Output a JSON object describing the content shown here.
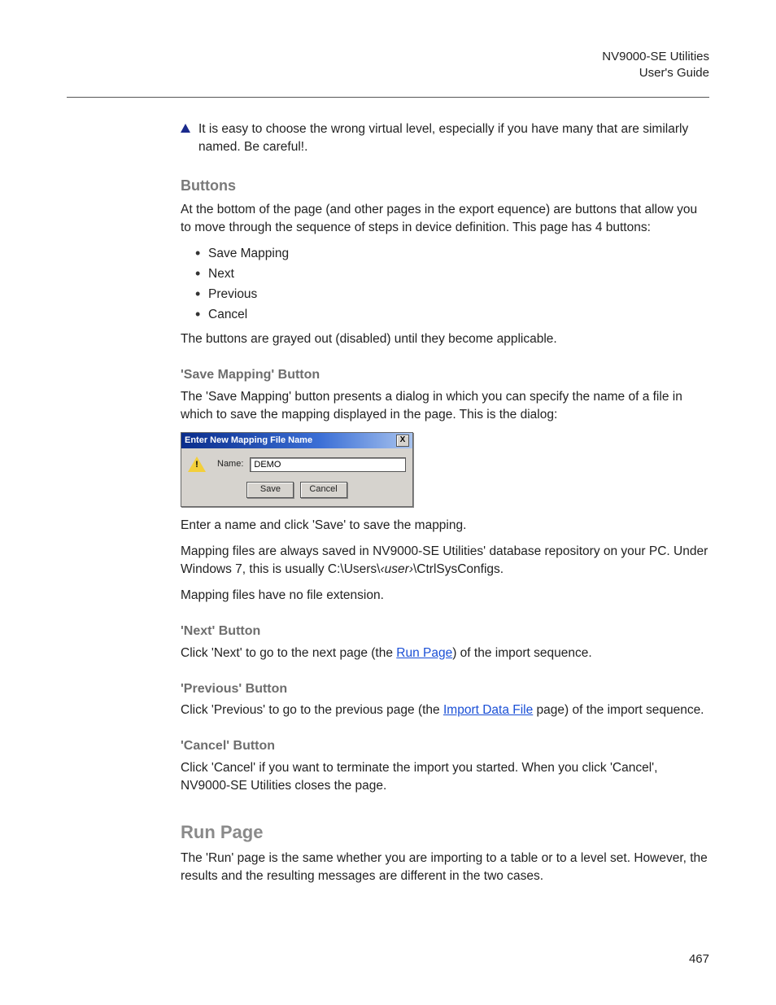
{
  "header": {
    "title": "NV9000-SE Utilities",
    "subtitle": "User's Guide"
  },
  "note": "It is easy to choose the wrong virtual level, especially if you have many that are similarly named. Be careful!.",
  "buttons_section": {
    "heading": "Buttons",
    "intro": "At the bottom of the page (and other pages in the export equence) are buttons that allow you to move through the sequence of steps in device definition. This page has 4 buttons:",
    "items": [
      "Save Mapping",
      "Next",
      "Previous",
      "Cancel"
    ],
    "outro": "The buttons are grayed out (disabled) until they become applicable."
  },
  "save_mapping": {
    "heading": "'Save Mapping' Button",
    "p1": "The 'Save Mapping' button presents a dialog in which you can specify the name of a file in which to save the mapping displayed in the page. This is the dialog:",
    "p2": "Enter a name and click 'Save' to save the mapping.",
    "p3_a": "Mapping files are always saved in NV9000-SE Utilities' database repository on your PC. Under Windows 7, this is usually C:\\Users\\",
    "p3_user": "‹user›",
    "p3_b": "\\CtrlSysConfigs.",
    "p4": "Mapping files have no file extension."
  },
  "dialog": {
    "title": "Enter New Mapping File Name",
    "close": "X",
    "label": "Name:",
    "value": "DEMO",
    "save": "Save",
    "cancel": "Cancel"
  },
  "next_btn": {
    "heading": "'Next' Button",
    "pre": "Click 'Next' to go to the next page (the ",
    "link": "Run Page",
    "post": ") of the import sequence."
  },
  "prev_btn": {
    "heading": "'Previous' Button",
    "pre": "Click 'Previous' to go to the previous page (the ",
    "link": "Import Data File",
    "post": " page) of the import sequence."
  },
  "cancel_btn": {
    "heading": "'Cancel' Button",
    "p": "Click 'Cancel' if you want to terminate the import you started. When you click 'Cancel', NV9000-SE Utilities closes the page."
  },
  "run_page": {
    "heading": "Run Page",
    "p": "The 'Run' page is the same whether you are importing to a table or to a level set. However, the results and the resulting messages are different in the two cases."
  },
  "page_number": "467"
}
